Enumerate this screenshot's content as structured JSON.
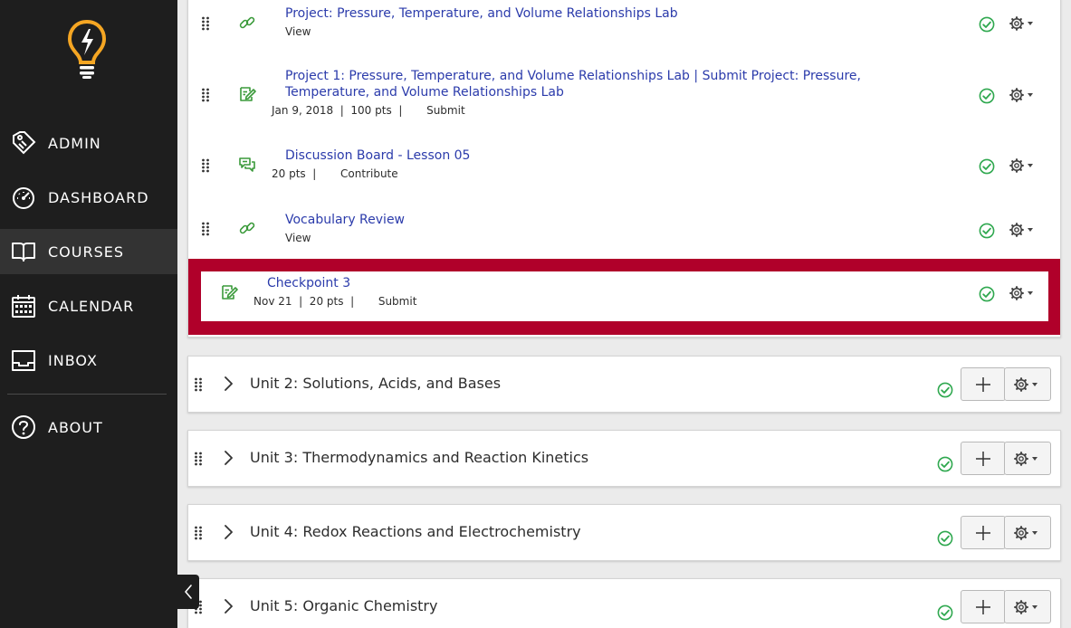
{
  "nav": {
    "items": [
      {
        "label": "ADMIN",
        "icon": "admin-tag-icon"
      },
      {
        "label": "DASHBOARD",
        "icon": "speedometer-icon"
      },
      {
        "label": "COURSES",
        "icon": "book-icon"
      },
      {
        "label": "CALENDAR",
        "icon": "calendar-icon"
      },
      {
        "label": "INBOX",
        "icon": "inbox-icon"
      },
      {
        "label": "ABOUT",
        "icon": "question-icon"
      }
    ],
    "active": "COURSES"
  },
  "items": [
    {
      "title": "Project: Pressure, Temperature, and Volume Relationships Lab",
      "meta": "View",
      "icon": "link-icon"
    },
    {
      "title_line1": "Project 1: Pressure, Temperature, and Volume Relationships Lab | Submit Project: Pressure,",
      "title_line2": "Temperature, and Volume Relationships Lab",
      "meta": "Jan 9, 2018  |  100 pts  |       Submit",
      "icon": "assignment-icon"
    },
    {
      "title": "Discussion Board - Lesson 05",
      "meta": "20 pts  |       Contribute",
      "icon": "discussion-icon"
    },
    {
      "title": "Vocabulary Review",
      "meta": "View",
      "icon": "link-icon"
    },
    {
      "title": "Checkpoint 3",
      "meta": "Nov 21  |  20 pts  |       Submit",
      "icon": "assignment-icon"
    }
  ],
  "units": [
    {
      "title": "Unit 2: Solutions, Acids, and Bases"
    },
    {
      "title": "Unit 3: Thermodynamics and Reaction Kinetics"
    },
    {
      "title": "Unit 4: Redox Reactions and Electrochemistry"
    },
    {
      "title": "Unit 5: Organic Chemistry"
    }
  ],
  "colors": {
    "sidebar": "#1e1e1e",
    "link": "#2b3bab",
    "highlight": "#b0002a",
    "check": "#2fa84f",
    "item_icon": "#3a9a3a"
  }
}
